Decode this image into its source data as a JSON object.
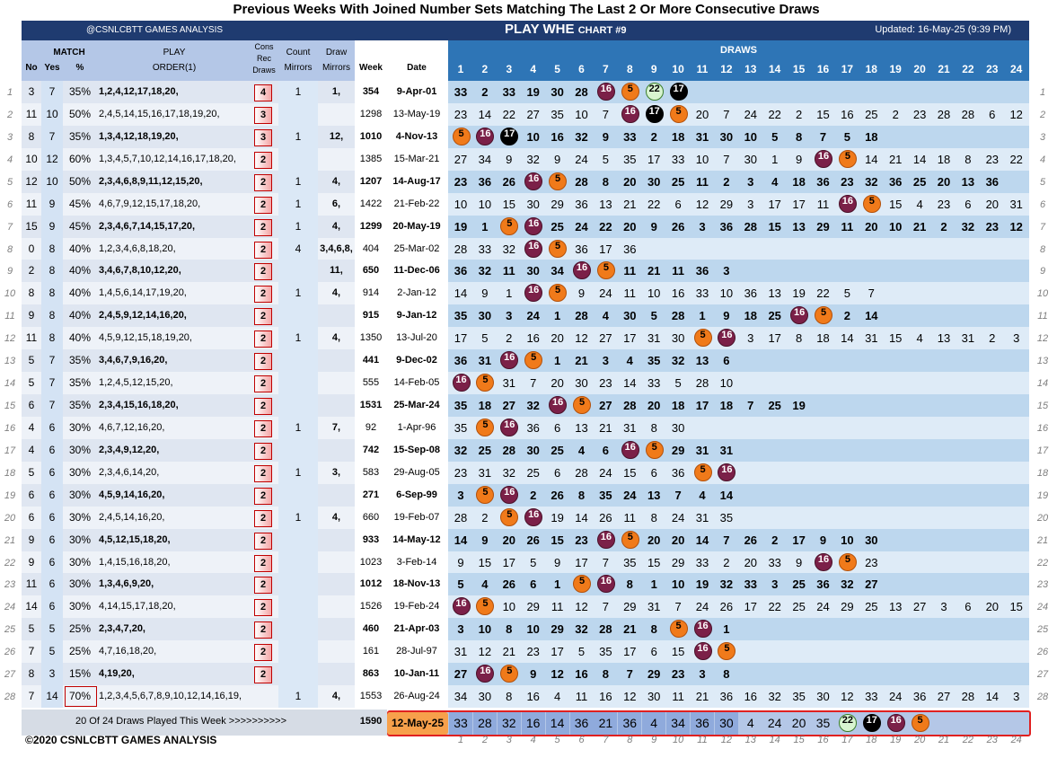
{
  "title": "Previous Weeks With Joined Number Sets Matching The Last 2 Or More Consecutive Draws",
  "header": {
    "brand": "@CSNLCBTT GAMES ANALYSIS",
    "game": "PLAY WHE",
    "chart": "CHART #9",
    "updated": "Updated: 16-May-25 (9:39 PM)"
  },
  "columns": {
    "match": "MATCH",
    "no": "No",
    "yes": "Yes",
    "pct": "%",
    "play": "PLAY",
    "order": "ORDER(1)",
    "cons": [
      "Cons",
      "Rec",
      "Draws"
    ],
    "count": [
      "Count",
      "Mirrors"
    ],
    "draw": [
      "Draw",
      "Mirrors"
    ],
    "week": "Week",
    "date": "Date",
    "draws": "DRAWS"
  },
  "draw_numbers": [
    "1",
    "2",
    "3",
    "4",
    "5",
    "6",
    "7",
    "8",
    "9",
    "10",
    "11",
    "12",
    "13",
    "14",
    "15",
    "16",
    "17",
    "18",
    "19",
    "20",
    "21",
    "22",
    "23",
    "24"
  ],
  "row_numbers": [
    "1",
    "2",
    "3",
    "4",
    "5",
    "6",
    "7",
    "8",
    "9",
    "10",
    "11",
    "12",
    "13",
    "14",
    "15",
    "16",
    "17",
    "18",
    "19",
    "20",
    "21",
    "22",
    "23",
    "24",
    "25",
    "26",
    "27",
    "28"
  ],
  "rows": [
    {
      "no": "3",
      "yes": "7",
      "pct": "35%",
      "play": "1,2,4,12,17,18,20,",
      "cons": "4",
      "count": "1",
      "dm": "1,",
      "week": "354",
      "date": "9-Apr-01",
      "bold": true,
      "draws": [
        "33",
        "2",
        "33",
        "19",
        "30",
        "28",
        "16",
        "5",
        "22",
        "17"
      ]
    },
    {
      "no": "11",
      "yes": "10",
      "pct": "50%",
      "play": "2,4,5,14,15,16,17,18,19,20,",
      "cons": "3",
      "count": "",
      "dm": "",
      "week": "1298",
      "date": "13-May-19",
      "bold": false,
      "draws": [
        "23",
        "14",
        "22",
        "27",
        "35",
        "10",
        "7",
        "16",
        "17",
        "5",
        "20",
        "7",
        "24",
        "22",
        "2",
        "15",
        "16",
        "25",
        "2",
        "23",
        "28",
        "28",
        "6",
        "12"
      ]
    },
    {
      "no": "8",
      "yes": "7",
      "pct": "35%",
      "play": "1,3,4,12,18,19,20,",
      "cons": "3",
      "count": "1",
      "dm": "12,",
      "week": "1010",
      "date": "4-Nov-13",
      "bold": true,
      "draws": [
        "5",
        "16",
        "17",
        "10",
        "16",
        "32",
        "9",
        "33",
        "2",
        "18",
        "31",
        "30",
        "10",
        "5",
        "8",
        "7",
        "5",
        "18"
      ]
    },
    {
      "no": "10",
      "yes": "12",
      "pct": "60%",
      "play": "1,3,4,5,7,10,12,14,16,17,18,20,",
      "cons": "2",
      "count": "",
      "dm": "",
      "week": "1385",
      "date": "15-Mar-21",
      "bold": false,
      "draws": [
        "27",
        "34",
        "9",
        "32",
        "9",
        "24",
        "5",
        "35",
        "17",
        "33",
        "10",
        "7",
        "30",
        "1",
        "9",
        "16",
        "5",
        "14",
        "21",
        "14",
        "18",
        "8",
        "23",
        "22"
      ]
    },
    {
      "no": "12",
      "yes": "10",
      "pct": "50%",
      "play": "2,3,4,6,8,9,11,12,15,20,",
      "cons": "2",
      "count": "1",
      "dm": "4,",
      "week": "1207",
      "date": "14-Aug-17",
      "bold": true,
      "draws": [
        "23",
        "36",
        "26",
        "16",
        "5",
        "28",
        "8",
        "20",
        "30",
        "25",
        "11",
        "2",
        "3",
        "4",
        "18",
        "36",
        "23",
        "32",
        "36",
        "25",
        "20",
        "13",
        "36"
      ]
    },
    {
      "no": "11",
      "yes": "9",
      "pct": "45%",
      "play": "4,6,7,9,12,15,17,18,20,",
      "cons": "2",
      "count": "1",
      "dm": "6,",
      "week": "1422",
      "date": "21-Feb-22",
      "bold": false,
      "draws": [
        "10",
        "10",
        "15",
        "30",
        "29",
        "36",
        "13",
        "21",
        "22",
        "6",
        "12",
        "29",
        "3",
        "17",
        "17",
        "11",
        "16",
        "5",
        "15",
        "4",
        "23",
        "6",
        "20",
        "31"
      ]
    },
    {
      "no": "15",
      "yes": "9",
      "pct": "45%",
      "play": "2,3,4,6,7,14,15,17,20,",
      "cons": "2",
      "count": "1",
      "dm": "4,",
      "week": "1299",
      "date": "20-May-19",
      "bold": true,
      "draws": [
        "19",
        "1",
        "5",
        "16",
        "25",
        "24",
        "22",
        "20",
        "9",
        "26",
        "3",
        "36",
        "28",
        "15",
        "13",
        "29",
        "11",
        "20",
        "10",
        "21",
        "2",
        "32",
        "23",
        "12"
      ]
    },
    {
      "no": "0",
      "yes": "8",
      "pct": "40%",
      "play": "1,2,3,4,6,8,18,20,",
      "cons": "2",
      "count": "4",
      "dm": "3,4,6,8,",
      "week": "404",
      "date": "25-Mar-02",
      "bold": false,
      "draws": [
        "28",
        "33",
        "32",
        "16",
        "5",
        "36",
        "17",
        "36"
      ]
    },
    {
      "no": "2",
      "yes": "8",
      "pct": "40%",
      "play": "3,4,6,7,8,10,12,20,",
      "cons": "2",
      "count": "",
      "dm": "11,",
      "week": "650",
      "date": "11-Dec-06",
      "bold": true,
      "draws": [
        "36",
        "32",
        "11",
        "30",
        "34",
        "16",
        "5",
        "11",
        "21",
        "11",
        "36",
        "3"
      ]
    },
    {
      "no": "8",
      "yes": "8",
      "pct": "40%",
      "play": "1,4,5,6,14,17,19,20,",
      "cons": "2",
      "count": "1",
      "dm": "4,",
      "week": "914",
      "date": "2-Jan-12",
      "bold": false,
      "draws": [
        "14",
        "9",
        "1",
        "16",
        "5",
        "9",
        "24",
        "11",
        "10",
        "16",
        "33",
        "10",
        "36",
        "13",
        "19",
        "22",
        "5",
        "7"
      ]
    },
    {
      "no": "9",
      "yes": "8",
      "pct": "40%",
      "play": "2,4,5,9,12,14,16,20,",
      "cons": "2",
      "count": "",
      "dm": "",
      "week": "915",
      "date": "9-Jan-12",
      "bold": true,
      "draws": [
        "35",
        "30",
        "3",
        "24",
        "1",
        "28",
        "4",
        "30",
        "5",
        "28",
        "1",
        "9",
        "18",
        "25",
        "16",
        "5",
        "2",
        "14"
      ]
    },
    {
      "no": "11",
      "yes": "8",
      "pct": "40%",
      "play": "4,5,9,12,15,18,19,20,",
      "cons": "2",
      "count": "1",
      "dm": "4,",
      "week": "1350",
      "date": "13-Jul-20",
      "bold": false,
      "draws": [
        "17",
        "5",
        "2",
        "16",
        "20",
        "12",
        "27",
        "17",
        "31",
        "30",
        "5",
        "16",
        "3",
        "17",
        "8",
        "18",
        "14",
        "31",
        "15",
        "4",
        "13",
        "31",
        "2",
        "3"
      ]
    },
    {
      "no": "5",
      "yes": "7",
      "pct": "35%",
      "play": "3,4,6,7,9,16,20,",
      "cons": "2",
      "count": "",
      "dm": "",
      "week": "441",
      "date": "9-Dec-02",
      "bold": true,
      "draws": [
        "36",
        "31",
        "16",
        "5",
        "1",
        "21",
        "3",
        "4",
        "35",
        "32",
        "13",
        "6"
      ]
    },
    {
      "no": "5",
      "yes": "7",
      "pct": "35%",
      "play": "1,2,4,5,12,15,20,",
      "cons": "2",
      "count": "",
      "dm": "",
      "week": "555",
      "date": "14-Feb-05",
      "bold": false,
      "draws": [
        "16",
        "5",
        "31",
        "7",
        "20",
        "30",
        "23",
        "14",
        "33",
        "5",
        "28",
        "10"
      ]
    },
    {
      "no": "6",
      "yes": "7",
      "pct": "35%",
      "play": "2,3,4,15,16,18,20,",
      "cons": "2",
      "count": "",
      "dm": "",
      "week": "1531",
      "date": "25-Mar-24",
      "bold": true,
      "draws": [
        "35",
        "18",
        "27",
        "32",
        "16",
        "5",
        "27",
        "28",
        "20",
        "18",
        "17",
        "18",
        "7",
        "25",
        "19"
      ]
    },
    {
      "no": "4",
      "yes": "6",
      "pct": "30%",
      "play": "4,6,7,12,16,20,",
      "cons": "2",
      "count": "1",
      "dm": "7,",
      "week": "92",
      "date": "1-Apr-96",
      "bold": false,
      "draws": [
        "35",
        "5",
        "16",
        "36",
        "6",
        "13",
        "21",
        "31",
        "8",
        "30"
      ]
    },
    {
      "no": "4",
      "yes": "6",
      "pct": "30%",
      "play": "2,3,4,9,12,20,",
      "cons": "2",
      "count": "",
      "dm": "",
      "week": "742",
      "date": "15-Sep-08",
      "bold": true,
      "draws": [
        "32",
        "25",
        "28",
        "30",
        "25",
        "4",
        "6",
        "16",
        "5",
        "29",
        "31",
        "31"
      ]
    },
    {
      "no": "5",
      "yes": "6",
      "pct": "30%",
      "play": "2,3,4,6,14,20,",
      "cons": "2",
      "count": "1",
      "dm": "3,",
      "week": "583",
      "date": "29-Aug-05",
      "bold": false,
      "draws": [
        "23",
        "31",
        "32",
        "25",
        "6",
        "28",
        "24",
        "15",
        "6",
        "36",
        "5",
        "16"
      ]
    },
    {
      "no": "6",
      "yes": "6",
      "pct": "30%",
      "play": "4,5,9,14,16,20,",
      "cons": "2",
      "count": "",
      "dm": "",
      "week": "271",
      "date": "6-Sep-99",
      "bold": true,
      "draws": [
        "3",
        "5",
        "16",
        "2",
        "26",
        "8",
        "35",
        "24",
        "13",
        "7",
        "4",
        "14"
      ]
    },
    {
      "no": "6",
      "yes": "6",
      "pct": "30%",
      "play": "2,4,5,14,16,20,",
      "cons": "2",
      "count": "1",
      "dm": "4,",
      "week": "660",
      "date": "19-Feb-07",
      "bold": false,
      "draws": [
        "28",
        "2",
        "5",
        "16",
        "19",
        "14",
        "26",
        "11",
        "8",
        "24",
        "31",
        "35"
      ]
    },
    {
      "no": "9",
      "yes": "6",
      "pct": "30%",
      "play": "4,5,12,15,18,20,",
      "cons": "2",
      "count": "",
      "dm": "",
      "week": "933",
      "date": "14-May-12",
      "bold": true,
      "draws": [
        "14",
        "9",
        "20",
        "26",
        "15",
        "23",
        "16",
        "5",
        "20",
        "20",
        "14",
        "7",
        "26",
        "2",
        "17",
        "9",
        "10",
        "30"
      ]
    },
    {
      "no": "9",
      "yes": "6",
      "pct": "30%",
      "play": "1,4,15,16,18,20,",
      "cons": "2",
      "count": "",
      "dm": "",
      "week": "1023",
      "date": "3-Feb-14",
      "bold": false,
      "draws": [
        "9",
        "15",
        "17",
        "5",
        "9",
        "17",
        "7",
        "35",
        "15",
        "29",
        "33",
        "2",
        "20",
        "33",
        "9",
        "16",
        "5",
        "23"
      ]
    },
    {
      "no": "11",
      "yes": "6",
      "pct": "30%",
      "play": "1,3,4,6,9,20,",
      "cons": "2",
      "count": "",
      "dm": "",
      "week": "1012",
      "date": "18-Nov-13",
      "bold": true,
      "draws": [
        "5",
        "4",
        "26",
        "6",
        "1",
        "5",
        "16",
        "8",
        "1",
        "10",
        "19",
        "32",
        "33",
        "3",
        "25",
        "36",
        "32",
        "27"
      ]
    },
    {
      "no": "14",
      "yes": "6",
      "pct": "30%",
      "play": "4,14,15,17,18,20,",
      "cons": "2",
      "count": "",
      "dm": "",
      "week": "1526",
      "date": "19-Feb-24",
      "bold": false,
      "draws": [
        "16",
        "5",
        "10",
        "29",
        "11",
        "12",
        "7",
        "29",
        "31",
        "7",
        "24",
        "26",
        "17",
        "22",
        "25",
        "24",
        "29",
        "25",
        "13",
        "27",
        "3",
        "6",
        "20",
        "15"
      ]
    },
    {
      "no": "5",
      "yes": "5",
      "pct": "25%",
      "play": "2,3,4,7,20,",
      "cons": "2",
      "count": "",
      "dm": "",
      "week": "460",
      "date": "21-Apr-03",
      "bold": true,
      "draws": [
        "3",
        "10",
        "8",
        "10",
        "29",
        "32",
        "28",
        "21",
        "8",
        "5",
        "16",
        "1"
      ]
    },
    {
      "no": "7",
      "yes": "5",
      "pct": "25%",
      "play": "4,7,16,18,20,",
      "cons": "2",
      "count": "",
      "dm": "",
      "week": "161",
      "date": "28-Jul-97",
      "bold": false,
      "draws": [
        "31",
        "12",
        "21",
        "23",
        "17",
        "5",
        "35",
        "17",
        "6",
        "15",
        "16",
        "5"
      ]
    },
    {
      "no": "8",
      "yes": "3",
      "pct": "15%",
      "play": "4,19,20,",
      "cons": "2",
      "count": "",
      "dm": "",
      "week": "863",
      "date": "10-Jan-11",
      "bold": true,
      "draws": [
        "27",
        "16",
        "5",
        "9",
        "12",
        "16",
        "8",
        "7",
        "29",
        "23",
        "3",
        "8"
      ]
    },
    {
      "no": "7",
      "yes": "14",
      "pct": "70%",
      "play": "1,2,3,4,5,6,7,8,9,10,12,14,16,19,",
      "cons": "",
      "count": "1",
      "dm": "4,",
      "week": "1553",
      "date": "26-Aug-24",
      "bold": false,
      "draws": [
        "34",
        "30",
        "8",
        "16",
        "4",
        "11",
        "16",
        "12",
        "30",
        "11",
        "21",
        "36",
        "16",
        "32",
        "35",
        "30",
        "12",
        "33",
        "24",
        "36",
        "27",
        "28",
        "14",
        "3"
      ]
    }
  ],
  "highlight_balls": {
    "r0": {
      "6": "16",
      "7": "5",
      "8": "22",
      "9": "17"
    },
    "r1": {
      "7": "16",
      "8": "17",
      "9": "5"
    },
    "r2": {
      "0": "5",
      "1": "16",
      "2": "17"
    },
    "r3": {
      "15": "16",
      "16": "5"
    },
    "r4": {
      "3": "16",
      "4": "5"
    },
    "r5": {
      "16": "16",
      "17": "5"
    },
    "r6": {
      "2": "5",
      "3": "16"
    },
    "r7": {
      "3": "16",
      "4": "5"
    },
    "r8": {
      "5": "16",
      "6": "5"
    },
    "r9": {
      "3": "16",
      "4": "5"
    },
    "r10": {
      "14": "16",
      "15": "5"
    },
    "r11": {
      "10": "5",
      "11": "16"
    },
    "r12": {
      "2": "16",
      "3": "5"
    },
    "r13": {
      "0": "16",
      "1": "5"
    },
    "r14": {
      "4": "16",
      "5": "5"
    },
    "r15": {
      "1": "5",
      "2": "16"
    },
    "r16": {
      "7": "16",
      "8": "5"
    },
    "r17": {
      "10": "5",
      "11": "16"
    },
    "r18": {
      "1": "5",
      "2": "16"
    },
    "r19": {
      "2": "5",
      "3": "16"
    },
    "r20": {
      "6": "16",
      "7": "5"
    },
    "r21": {
      "15": "16",
      "16": "5"
    },
    "r22": {
      "5": "5",
      "6": "16"
    },
    "r23": {
      "0": "16",
      "1": "5"
    },
    "r24": {
      "9": "5",
      "10": "16"
    },
    "r25": {
      "10": "16",
      "11": "5"
    },
    "r26": {
      "1": "16",
      "2": "5"
    }
  },
  "current": {
    "label": "20 Of 24 Draws Played This Week  >>>>>>>>>>",
    "week": "1590",
    "date": "12-May-25",
    "draws": [
      "33",
      "28",
      "32",
      "16",
      "14",
      "36",
      "21",
      "36",
      "4",
      "34",
      "36",
      "30",
      "4",
      "24",
      "20",
      "35",
      "22",
      "17",
      "16",
      "5"
    ]
  },
  "copyright": "©2020 CSNLCBTT GAMES ANALYSIS",
  "colors": {
    "header": "#1f3b70",
    "draws_header": "#2e75b6",
    "ball16": "#7b2048",
    "ball5": "#f07a1a",
    "ball17": "#000000",
    "ball22": "#d8f4d0"
  },
  "chart_data": {
    "type": "table",
    "title": "Previous Weeks With Joined Number Sets Matching The Last 2 Or More Consecutive Draws",
    "columns": [
      "No",
      "Yes",
      "%",
      "PLAY ORDER(1)",
      "Cons Rec Draws",
      "Count Mirrors",
      "Draw Mirrors",
      "Week",
      "Date",
      "DRAWS 1-24"
    ],
    "current_week": {
      "week": "1590",
      "date": "12-May-25",
      "draws_played": 20,
      "draws_total": 24
    }
  }
}
